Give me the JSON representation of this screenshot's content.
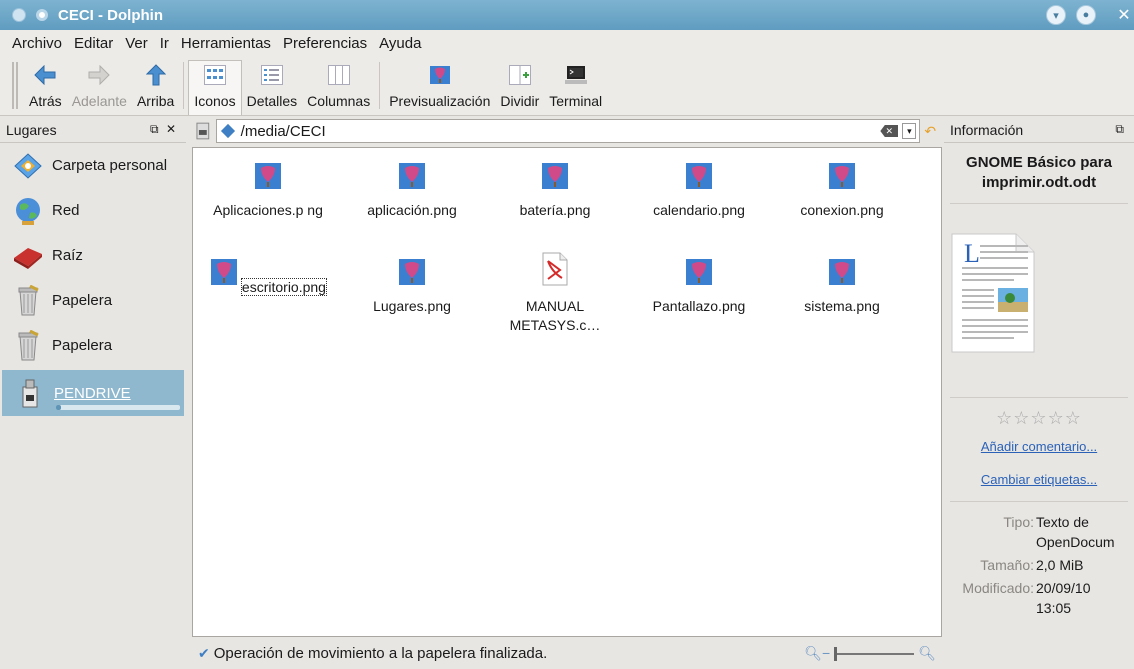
{
  "window": {
    "title": "CECI - Dolphin"
  },
  "menubar": [
    "Archivo",
    "Editar",
    "Ver",
    "Ir",
    "Herramientas",
    "Preferencias",
    "Ayuda"
  ],
  "toolbar": {
    "back": "Atrás",
    "forward": "Adelante",
    "up": "Arriba",
    "icons": "Iconos",
    "details": "Detalles",
    "columns": "Columnas",
    "preview": "Previsualización",
    "split": "Dividir",
    "terminal": "Terminal"
  },
  "places": {
    "title": "Lugares",
    "items": [
      "Carpeta personal",
      "Red",
      "Raíz",
      "Papelera",
      "Papelera",
      "PENDRIVE"
    ],
    "pendrive_usage": 0.04
  },
  "location": {
    "path": "/media/CECI"
  },
  "files": [
    {
      "name": "Aplicaciones.p ng",
      "type": "image"
    },
    {
      "name": "aplicación.png",
      "type": "image"
    },
    {
      "name": "batería.png",
      "type": "image"
    },
    {
      "name": "calendario.png",
      "type": "image"
    },
    {
      "name": "conexion.png",
      "type": "image"
    },
    {
      "name": "escritorio.png",
      "type": "image"
    },
    {
      "name": "Lugares.png",
      "type": "image"
    },
    {
      "name": "MANUAL METASYS.c…",
      "type": "pdf"
    },
    {
      "name": "Pantallazo.png",
      "type": "image"
    },
    {
      "name": "sistema.png",
      "type": "image"
    }
  ],
  "status": {
    "message": "Operación de movimiento a la papelera finalizada."
  },
  "info": {
    "title": "Información",
    "file_name": "GNOME Básico para imprimir.odt.odt",
    "add_comment": "Añadir comentario...",
    "change_tags": "Cambiar etiquetas...",
    "type_label": "Tipo:",
    "type_value": "Texto de OpenDocum",
    "size_label": "Tamaño:",
    "size_value": "2,0 MiB",
    "modified_label": "Modificado:",
    "modified_value": "20/09/10 13:05",
    "rating": 0
  },
  "colors": {
    "titlebar": "#6aa6c9",
    "selection": "#8fb7ce",
    "link": "#2b62b8"
  }
}
